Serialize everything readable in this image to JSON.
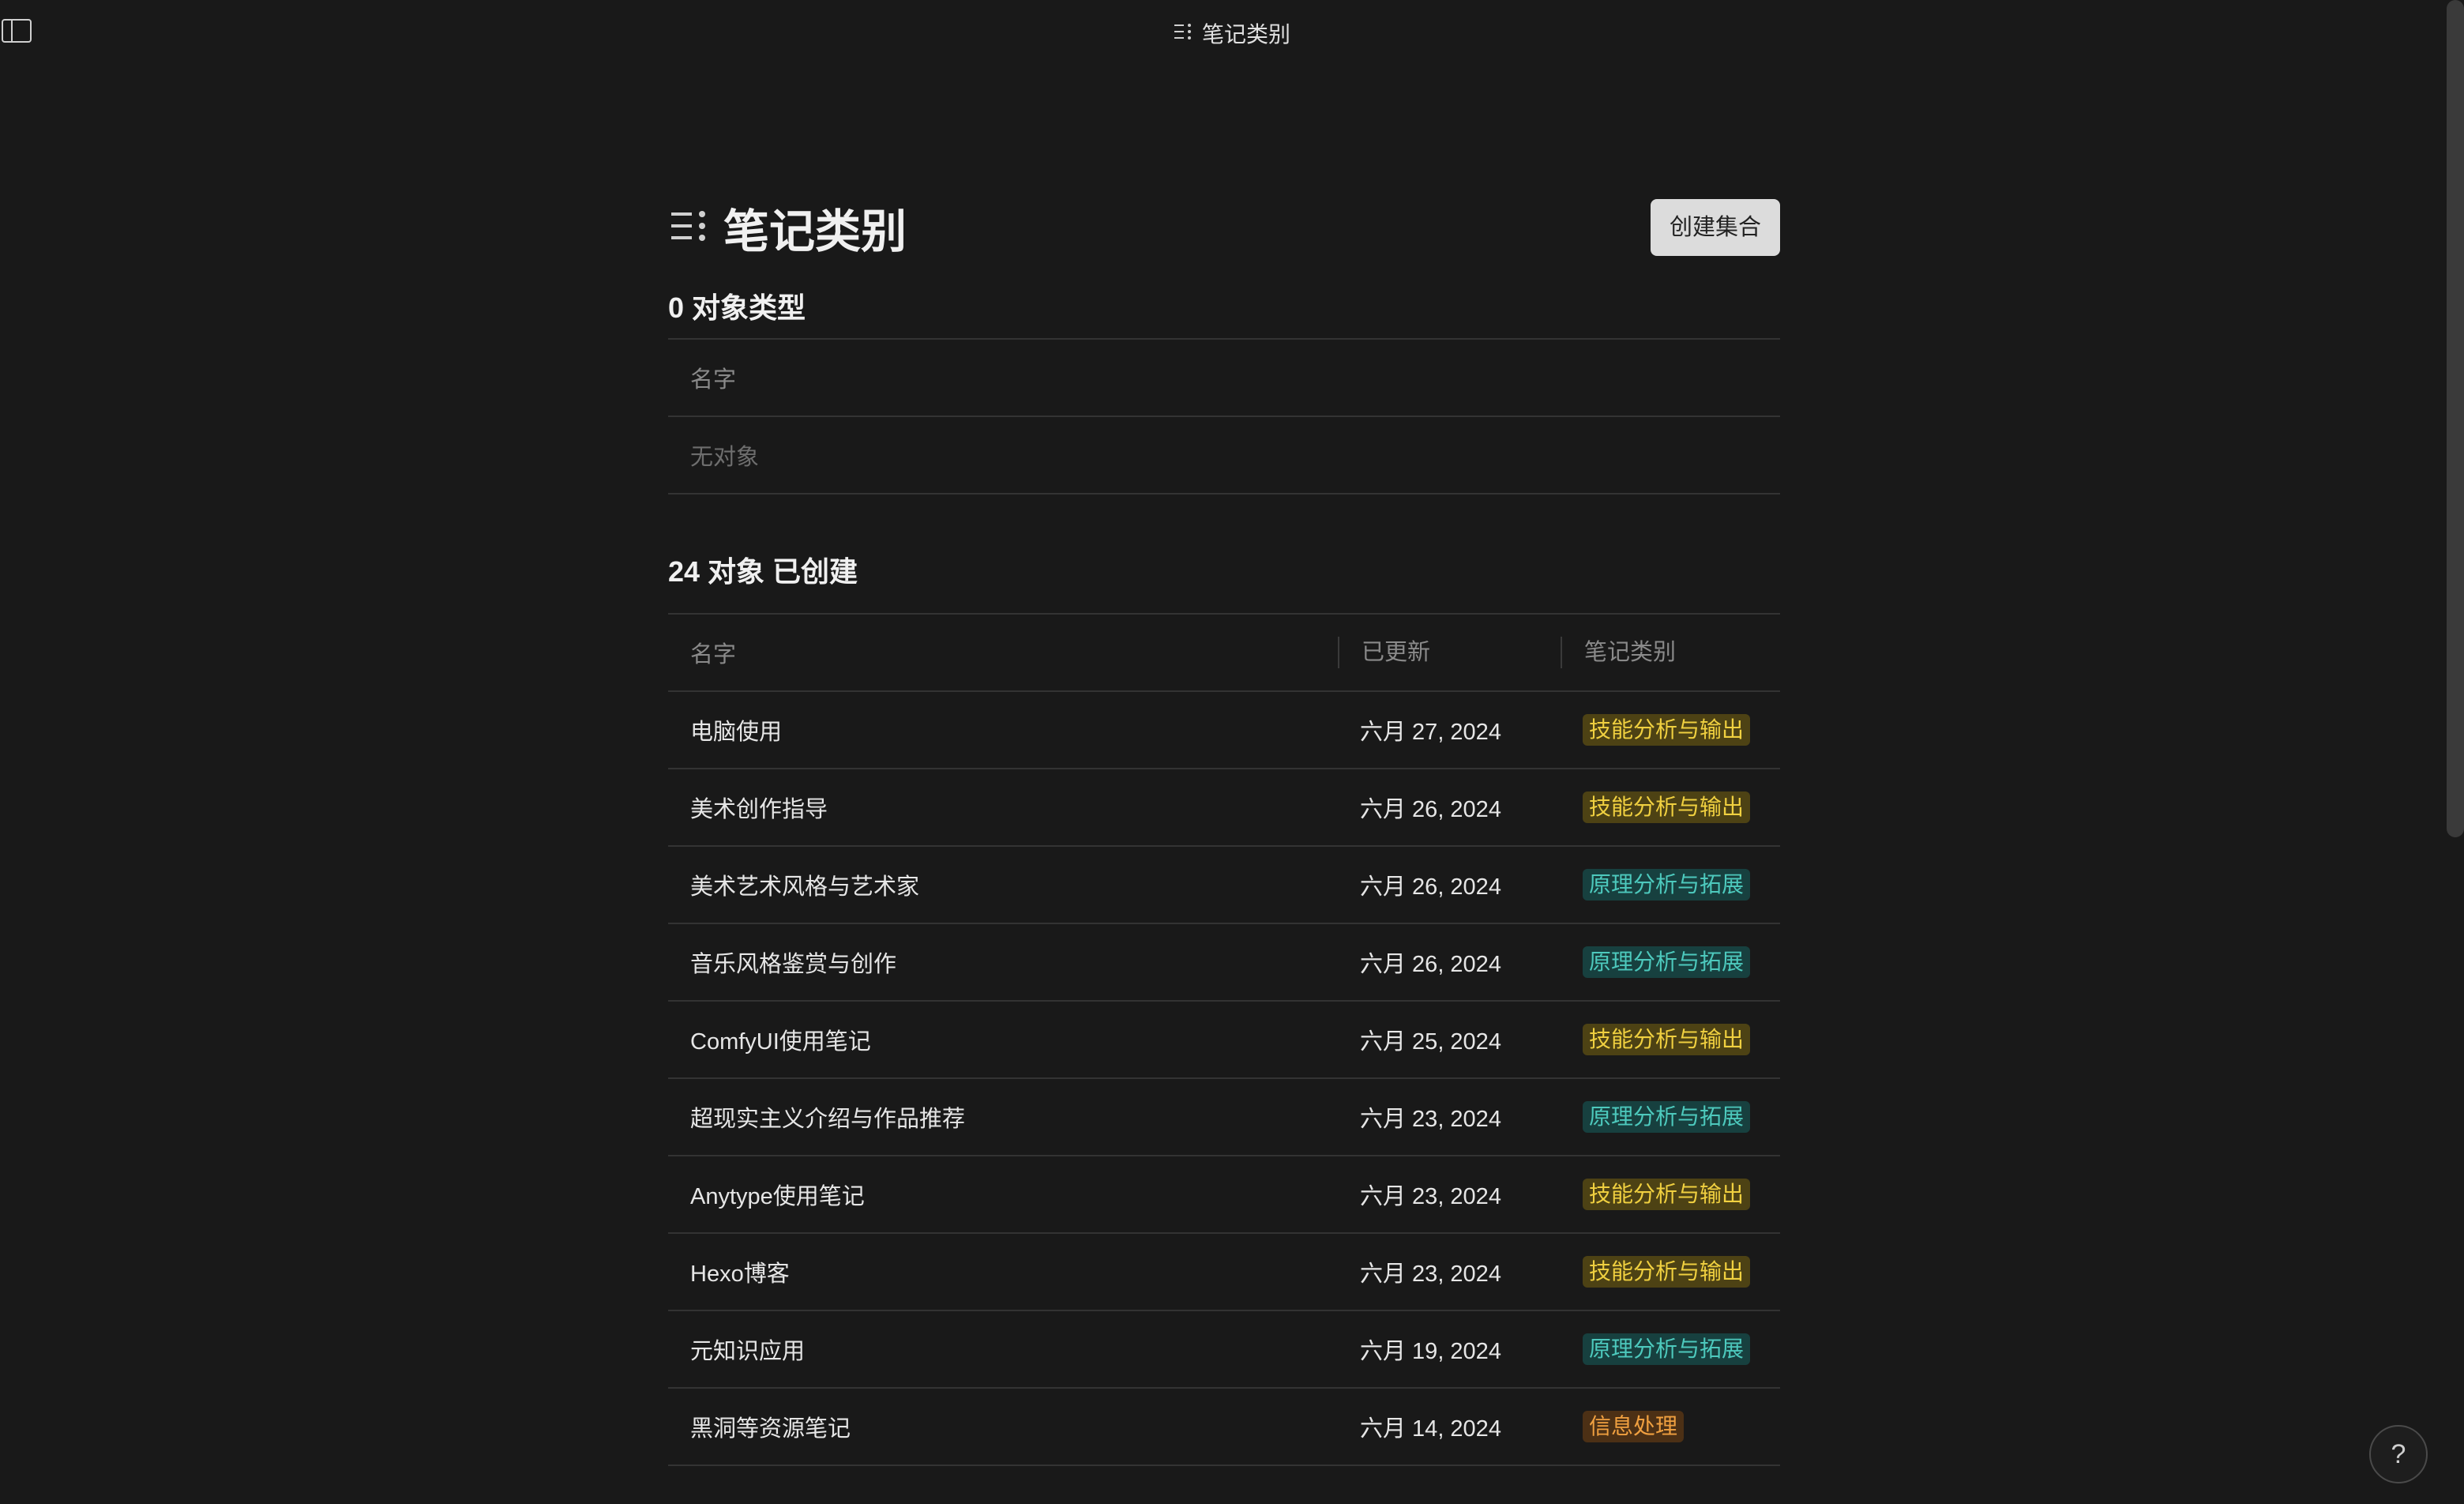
{
  "topbar": {
    "title": "笔记类别"
  },
  "header": {
    "title": "笔记类别",
    "create_button": "创建集合"
  },
  "types_section": {
    "heading": "0 对象类型",
    "column_name": "名字",
    "empty_text": "无对象"
  },
  "objects_section": {
    "heading": "24 对象 已创建",
    "columns": {
      "name": "名字",
      "updated": "已更新",
      "category": "笔记类别"
    },
    "rows": [
      {
        "name": "电脑使用",
        "updated": "六月 27, 2024",
        "category": "技能分析与输出",
        "color": "yellow"
      },
      {
        "name": "美术创作指导",
        "updated": "六月 26, 2024",
        "category": "技能分析与输出",
        "color": "yellow"
      },
      {
        "name": "美术艺术风格与艺术家",
        "updated": "六月 26, 2024",
        "category": "原理分析与拓展",
        "color": "teal"
      },
      {
        "name": "音乐风格鉴赏与创作",
        "updated": "六月 26, 2024",
        "category": "原理分析与拓展",
        "color": "teal"
      },
      {
        "name": "ComfyUI使用笔记",
        "updated": "六月 25, 2024",
        "category": "技能分析与输出",
        "color": "yellow"
      },
      {
        "name": "超现实主义介绍与作品推荐",
        "updated": "六月 23, 2024",
        "category": "原理分析与拓展",
        "color": "teal"
      },
      {
        "name": "Anytype使用笔记",
        "updated": "六月 23, 2024",
        "category": "技能分析与输出",
        "color": "yellow"
      },
      {
        "name": "Hexo博客",
        "updated": "六月 23, 2024",
        "category": "技能分析与输出",
        "color": "yellow"
      },
      {
        "name": "元知识应用",
        "updated": "六月 19, 2024",
        "category": "原理分析与拓展",
        "color": "teal"
      },
      {
        "name": "黑洞等资源笔记",
        "updated": "六月 14, 2024",
        "category": "信息处理",
        "color": "orange"
      }
    ]
  },
  "help_button": "?",
  "colors": {
    "background": "#191919",
    "yellow_tag": "#f0d040",
    "teal_tag": "#4dc9bd",
    "orange_tag": "#f0a040"
  }
}
